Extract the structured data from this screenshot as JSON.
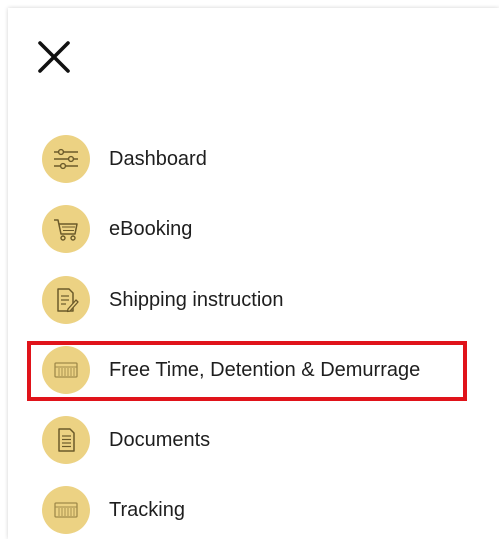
{
  "close": {
    "icon": "close-icon"
  },
  "accent_color": "#ecd283",
  "highlight_color": "#e0131a",
  "menu": {
    "items": [
      {
        "label": "Dashboard",
        "icon": "sliders-icon"
      },
      {
        "label": "eBooking",
        "icon": "cart-icon"
      },
      {
        "label": "Shipping instruction",
        "icon": "document-edit-icon"
      },
      {
        "label": "Free Time, Detention & Demurrage",
        "icon": "container-icon",
        "highlighted": true
      },
      {
        "label": "Documents",
        "icon": "document-icon"
      },
      {
        "label": "Tracking",
        "icon": "container-icon"
      }
    ]
  }
}
